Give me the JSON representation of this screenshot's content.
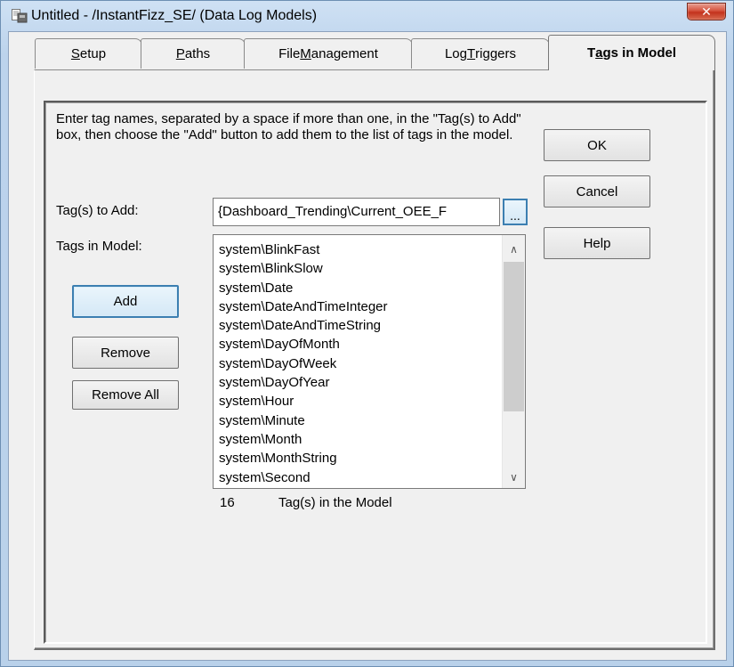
{
  "window": {
    "title": "Untitled - /InstantFizz_SE/ (Data Log Models)",
    "close_symbol": "✕"
  },
  "tabs": [
    {
      "label_pre": "",
      "label_key": "S",
      "label_post": "etup"
    },
    {
      "label_pre": "",
      "label_key": "P",
      "label_post": "aths"
    },
    {
      "label_pre": "File ",
      "label_key": "M",
      "label_post": "anagement"
    },
    {
      "label_pre": "Log ",
      "label_key": "T",
      "label_post": "riggers"
    },
    {
      "label_pre": "T",
      "label_key": "a",
      "label_post": "gs in Model",
      "selected": true
    }
  ],
  "instructions": "Enter tag names, separated by a space if more than one, in the \"Tag(s) to Add\" box, then choose the \"Add\"  button to add them to the list of tags in the model.",
  "form": {
    "tags_to_add_label": "Tag(s) to Add:",
    "tags_to_add_value": "{Dashboard_Trending\\Current_OEE_F",
    "browse_label": "...",
    "tags_in_model_label": "Tags in Model:"
  },
  "buttons": {
    "ok": "OK",
    "cancel": "Cancel",
    "help": "Help",
    "add": "Add",
    "remove": "Remove",
    "remove_all": "Remove All"
  },
  "tags": [
    "system\\BlinkFast",
    "system\\BlinkSlow",
    "system\\Date",
    "system\\DateAndTimeInteger",
    "system\\DateAndTimeString",
    "system\\DayOfMonth",
    "system\\DayOfWeek",
    "system\\DayOfYear",
    "system\\Hour",
    "system\\Minute",
    "system\\Month",
    "system\\MonthString",
    "system\\Second"
  ],
  "scroll": {
    "up_symbol": "∧",
    "down_symbol": "∨"
  },
  "count": {
    "value": "16",
    "label": "Tag(s) in the Model"
  },
  "colors": {
    "title_bg": "#bcd3ec",
    "close_red": "#c3321d",
    "default_border": "#3c7fb1"
  }
}
